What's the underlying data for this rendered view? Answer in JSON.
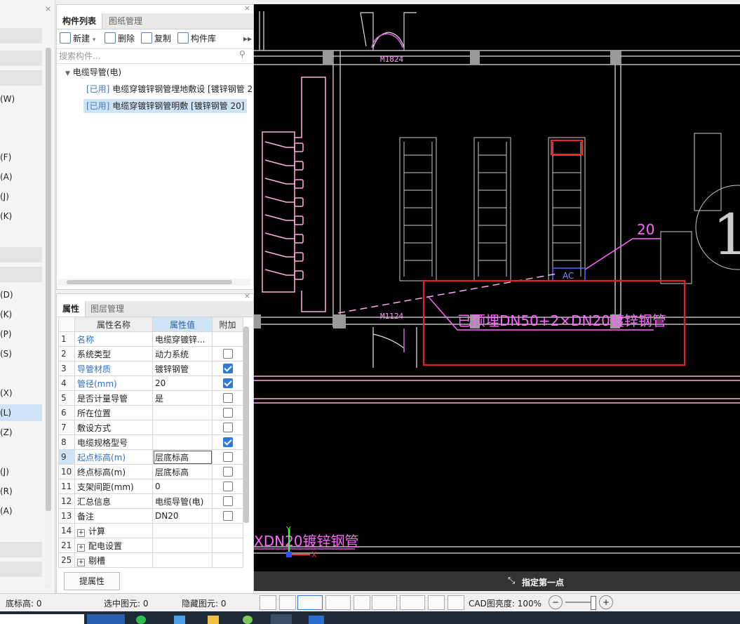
{
  "left_panel": {
    "codes": [
      "(W)",
      "(F)",
      "(A)",
      "(J)",
      "(K)",
      "(D)",
      "(K)",
      "(P)",
      "(S)",
      "(X)",
      "(L)",
      "(Z)",
      "(J)",
      "(R)",
      "(A)"
    ]
  },
  "component_panel": {
    "tabs": [
      "构件列表",
      "图纸管理"
    ],
    "toolbar": {
      "new": "新建",
      "delete": "删除",
      "copy": "复制",
      "library": "构件库"
    },
    "search_placeholder": "搜索构件...",
    "tree": {
      "group": "电缆导管(电)",
      "items": [
        {
          "tag": "[已用]",
          "label": "电缆穿镀锌钢管埋地敷设 [镀锌钢管 2"
        },
        {
          "tag": "[已用]",
          "label": "电缆穿镀锌钢管明敷 [镀锌钢管 20]"
        }
      ]
    }
  },
  "property_panel": {
    "tabs": [
      "属性",
      "图层管理"
    ],
    "headers": [
      "属性名称",
      "属性值",
      "附加"
    ],
    "rows": [
      {
        "num": "1",
        "name": "名称",
        "value": "电缆穿镀锌...",
        "check": "none"
      },
      {
        "num": "2",
        "name": "系统类型",
        "value": "动力系统",
        "check": "off"
      },
      {
        "num": "3",
        "name": "导管材质",
        "value": "镀锌钢管",
        "check": "on"
      },
      {
        "num": "4",
        "name": "管径(mm)",
        "value": "20",
        "check": "on"
      },
      {
        "num": "5",
        "name": "是否计量导管",
        "value": "是",
        "check": "off"
      },
      {
        "num": "6",
        "name": "所在位置",
        "value": "",
        "check": "off"
      },
      {
        "num": "7",
        "name": "敷设方式",
        "value": "",
        "check": "off"
      },
      {
        "num": "8",
        "name": "电缆规格型号",
        "value": "",
        "check": "on"
      },
      {
        "num": "9",
        "name": "起点标高(m)",
        "value": "层底标高",
        "check": "off"
      },
      {
        "num": "10",
        "name": "终点标高(m)",
        "value": "层底标高",
        "check": "off"
      },
      {
        "num": "11",
        "name": "支架间距(mm)",
        "value": "0",
        "check": "off"
      },
      {
        "num": "12",
        "name": "汇总信息",
        "value": "电缆导管(电)",
        "check": "off"
      },
      {
        "num": "13",
        "name": "备注",
        "value": "DN20",
        "check": "off"
      },
      {
        "num": "14",
        "name": "计算",
        "value": "",
        "check": "group"
      },
      {
        "num": "21",
        "name": "配电设置",
        "value": "",
        "check": "group"
      },
      {
        "num": "25",
        "name": "剔槽",
        "value": "",
        "check": "group"
      }
    ],
    "extract_button": "提属性"
  },
  "cad": {
    "door_labels": [
      "M1824",
      "M1124"
    ],
    "annotation_number": "20",
    "annotation_main": "已预埋DN50+2×DN20镀锌钢管",
    "annotation_bottom": "XDN20镀锌钢管",
    "ac_label": "AC",
    "big_number": "1",
    "axis_y": "Y",
    "axis_x": "X",
    "prompt": "指定第一点"
  },
  "status_bar": {
    "floor_height_label": "底标高: 0",
    "selected_label": "选中图元: 0",
    "hidden_label": "隐藏图元: 0",
    "brightness_label": "CAD图亮度: 100%"
  },
  "colors": {
    "highlight_red": "#e3241b",
    "annotation_pink": "#ff66ff",
    "selection_blue": "#cfe3f7",
    "check_blue": "#2f7ad8"
  }
}
